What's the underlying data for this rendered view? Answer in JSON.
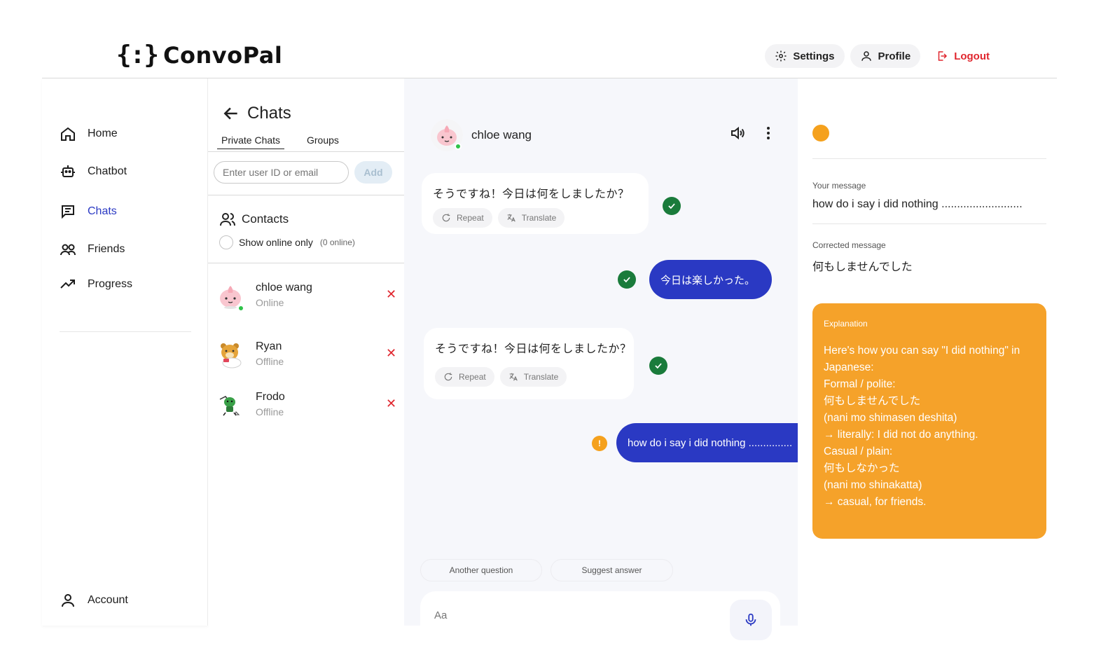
{
  "brand": {
    "logo_mark": "{:}",
    "name": "ConvoPal"
  },
  "header": {
    "settings_label": "Settings",
    "profile_label": "Profile",
    "logout_label": "Logout"
  },
  "sidebar": {
    "items": [
      {
        "label": "Home",
        "icon": "home-icon"
      },
      {
        "label": "Chatbot",
        "icon": "robot-icon"
      },
      {
        "label": "Chats",
        "icon": "chat-icon",
        "active": true
      },
      {
        "label": "Friends",
        "icon": "friends-icon"
      },
      {
        "label": "Progress",
        "icon": "trend-icon"
      }
    ],
    "account_label": "Account"
  },
  "chatlist": {
    "title": "Chats",
    "tabs": [
      "Private Chats",
      "Groups"
    ],
    "search_placeholder": "Enter user ID or email",
    "add_label": "Add",
    "contacts_label": "Contacts",
    "online_only_label": "Show online only",
    "online_count": "(0 online)",
    "contacts": [
      {
        "name": "chloe wang",
        "status": "Online"
      },
      {
        "name": "Ryan",
        "status": "Offline"
      },
      {
        "name": "Frodo",
        "status": "Offline"
      }
    ]
  },
  "conversation": {
    "contact_name": "chloe wang",
    "messages": [
      {
        "direction": "in",
        "text": "そうですね！今日は何をしましたか？",
        "status": "correct"
      },
      {
        "direction": "out",
        "text": "今日は楽しかった。",
        "status": "correct"
      },
      {
        "direction": "in",
        "text": "そうですね！今日は何をしましたか？",
        "status": "correct"
      },
      {
        "direction": "out",
        "text": "how do i say i did nothing ...............",
        "status": "warning"
      }
    ],
    "repeat_label": "Repeat",
    "translate_label": "Translate",
    "quick_replies": [
      "Another question",
      "Suggest answer"
    ],
    "composer_placeholder": "Aa"
  },
  "feedback": {
    "your_message_label": "Your message",
    "your_message": "how do i say i did nothing ..........................",
    "corrected_label": "Corrected message",
    "corrected_message": "何もしませんでした",
    "explanation_label": "Explanation",
    "explanation_lines": [
      "Here's how you can say \"I did nothing\" in",
      "Japanese:",
      "Formal / polite:",
      "何もしませんでした",
      " (nani mo shimasen deshita)",
      " → literally: I did not do anything.",
      "Casual / plain:",
      "何もしなかった",
      " (nani mo shinakatta)",
      " → casual, for friends."
    ]
  },
  "colors": {
    "accent": "#2a39c3",
    "success": "#1a7b3b",
    "warning": "#f5a11d",
    "danger": "#e0262e",
    "online": "#2fc34a"
  }
}
